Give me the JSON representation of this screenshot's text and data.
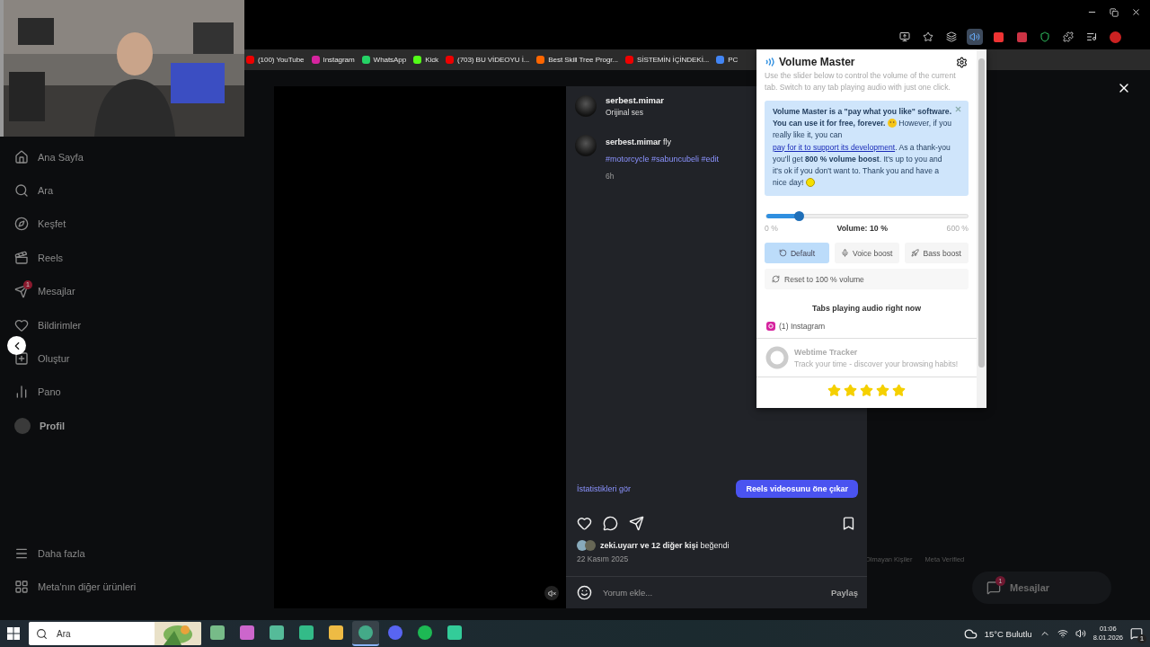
{
  "browser": {
    "bookmarks": [
      {
        "label": "(100) YouTube"
      },
      {
        "label": "Instagram"
      },
      {
        "label": "WhatsApp"
      },
      {
        "label": "Kick"
      },
      {
        "label": "(703) BU VİDEOYU İ..."
      },
      {
        "label": "Best Skill Tree Progr..."
      },
      {
        "label": "SİSTEMİN İÇİNDEKİ..."
      },
      {
        "label": "PC"
      }
    ]
  },
  "sidebar": {
    "items": [
      {
        "label": "Ana Sayfa",
        "kind": "link"
      },
      {
        "label": "Ara",
        "kind": "link"
      },
      {
        "label": "Keşfet",
        "kind": "link"
      },
      {
        "label": "Reels",
        "kind": "link"
      },
      {
        "label": "Mesajlar",
        "kind": "link",
        "badge": "1"
      },
      {
        "label": "Bildirimler",
        "kind": "link"
      },
      {
        "label": "Oluştur",
        "kind": "link"
      },
      {
        "label": "Pano",
        "kind": "link"
      },
      {
        "label": "Profil",
        "kind": "profile"
      }
    ],
    "bottom_items": [
      {
        "label": "Daha fazla"
      },
      {
        "label": "Meta'nın diğer ürünleri"
      }
    ]
  },
  "post": {
    "author": "serbest.mimar",
    "audio": "Orijinal ses",
    "caption_author": "serbest.mimar",
    "caption": "fly",
    "hashtags": "#motorcycle #sabuncubeli #edit",
    "age": "6h",
    "insights_link": "İstatistikleri gör",
    "boost_button": "Reels videosunu öne çıkar",
    "likes": "**zeki.uyarr ve 12 diğer kişi** beğendi",
    "date": "22 Kasım 2025",
    "comment": {
      "placeholder": "Yorum ekle..."
    },
    "share_button": "Paylaş"
  },
  "background": {
    "footer_links": [
      "Olmayan Kişiler",
      "Meta Verified"
    ],
    "messages_pill": {
      "label": "Mesajlar",
      "badge": "1"
    }
  },
  "extension_popup": {
    "title": "Volume Master",
    "description": "Use the slider below to control the volume of the current tab. Switch to any tab playing audio with just one click.",
    "notice": {
      "lead": "**Volume Master is a \"pay what you like\" software. You can use it for free, forever.**",
      "middle": "However, if you really like it, you can",
      "link": "pay for it to support its development",
      "tail": ". As a thank-you you'll get **800 % volume boost**. It's up to you and it's ok if you don't want to. Thank you and have a nice day!"
    },
    "slider": {
      "level": 0.16,
      "min_label": "0 %",
      "reading": "Volume: 10 %",
      "max_label": "600 %"
    },
    "presets": [
      {
        "label": "Default",
        "selected": true
      },
      {
        "label": "Voice boost",
        "selected": false
      },
      {
        "label": "Bass boost",
        "selected": false
      }
    ],
    "reset_button": "Reset to 100 % volume",
    "tabs_heading": "Tabs playing audio right now",
    "tabs": [
      {
        "label": "(1) Instagram"
      }
    ],
    "promo": {
      "title": "Webtime Tracker",
      "subtitle": "Track your time - discover your browsing habits!"
    },
    "stars": 5
  },
  "taskbar": {
    "search": {
      "placeholder": "Ara"
    },
    "apps": [
      {
        "selected": false
      },
      {
        "selected": false
      },
      {
        "selected": false
      },
      {
        "selected": false
      },
      {
        "selected": false
      },
      {
        "selected": true
      },
      {
        "selected": false
      },
      {
        "selected": false
      },
      {
        "selected": false
      }
    ],
    "weather": "15°C Bulutlu",
    "time": "01:06",
    "date": "8.01.2026",
    "notifications": "1"
  }
}
